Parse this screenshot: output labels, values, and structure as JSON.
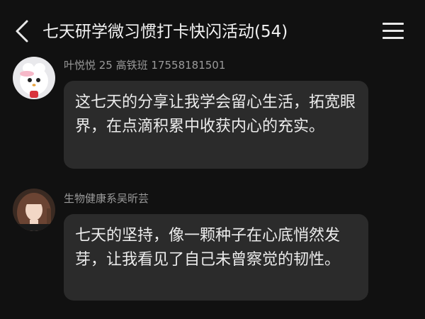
{
  "header": {
    "title": "七天研学微习惯打卡快闪活动(54)",
    "back_icon": "chevron-left-icon",
    "menu_icon": "hamburger-menu-icon"
  },
  "messages": [
    {
      "sender": "叶悦悦 25 高铁班 17558181501",
      "avatar": "white-cat-avatar",
      "text": "这七天的分享让我学会留心生活，拓宽眼界，在点滴积累中收获内心的充实。"
    },
    {
      "sender": "生物健康系吴昕芸",
      "avatar": "girl-photo-avatar",
      "text": "七天的坚持，像一颗种子在心底悄然发芽，让我看见了自己未曾察觉的韧性。"
    }
  ],
  "colors": {
    "background": "#111111",
    "bubble": "#2b2b2b",
    "text": "#ececec",
    "sender": "#9a9a9a"
  }
}
